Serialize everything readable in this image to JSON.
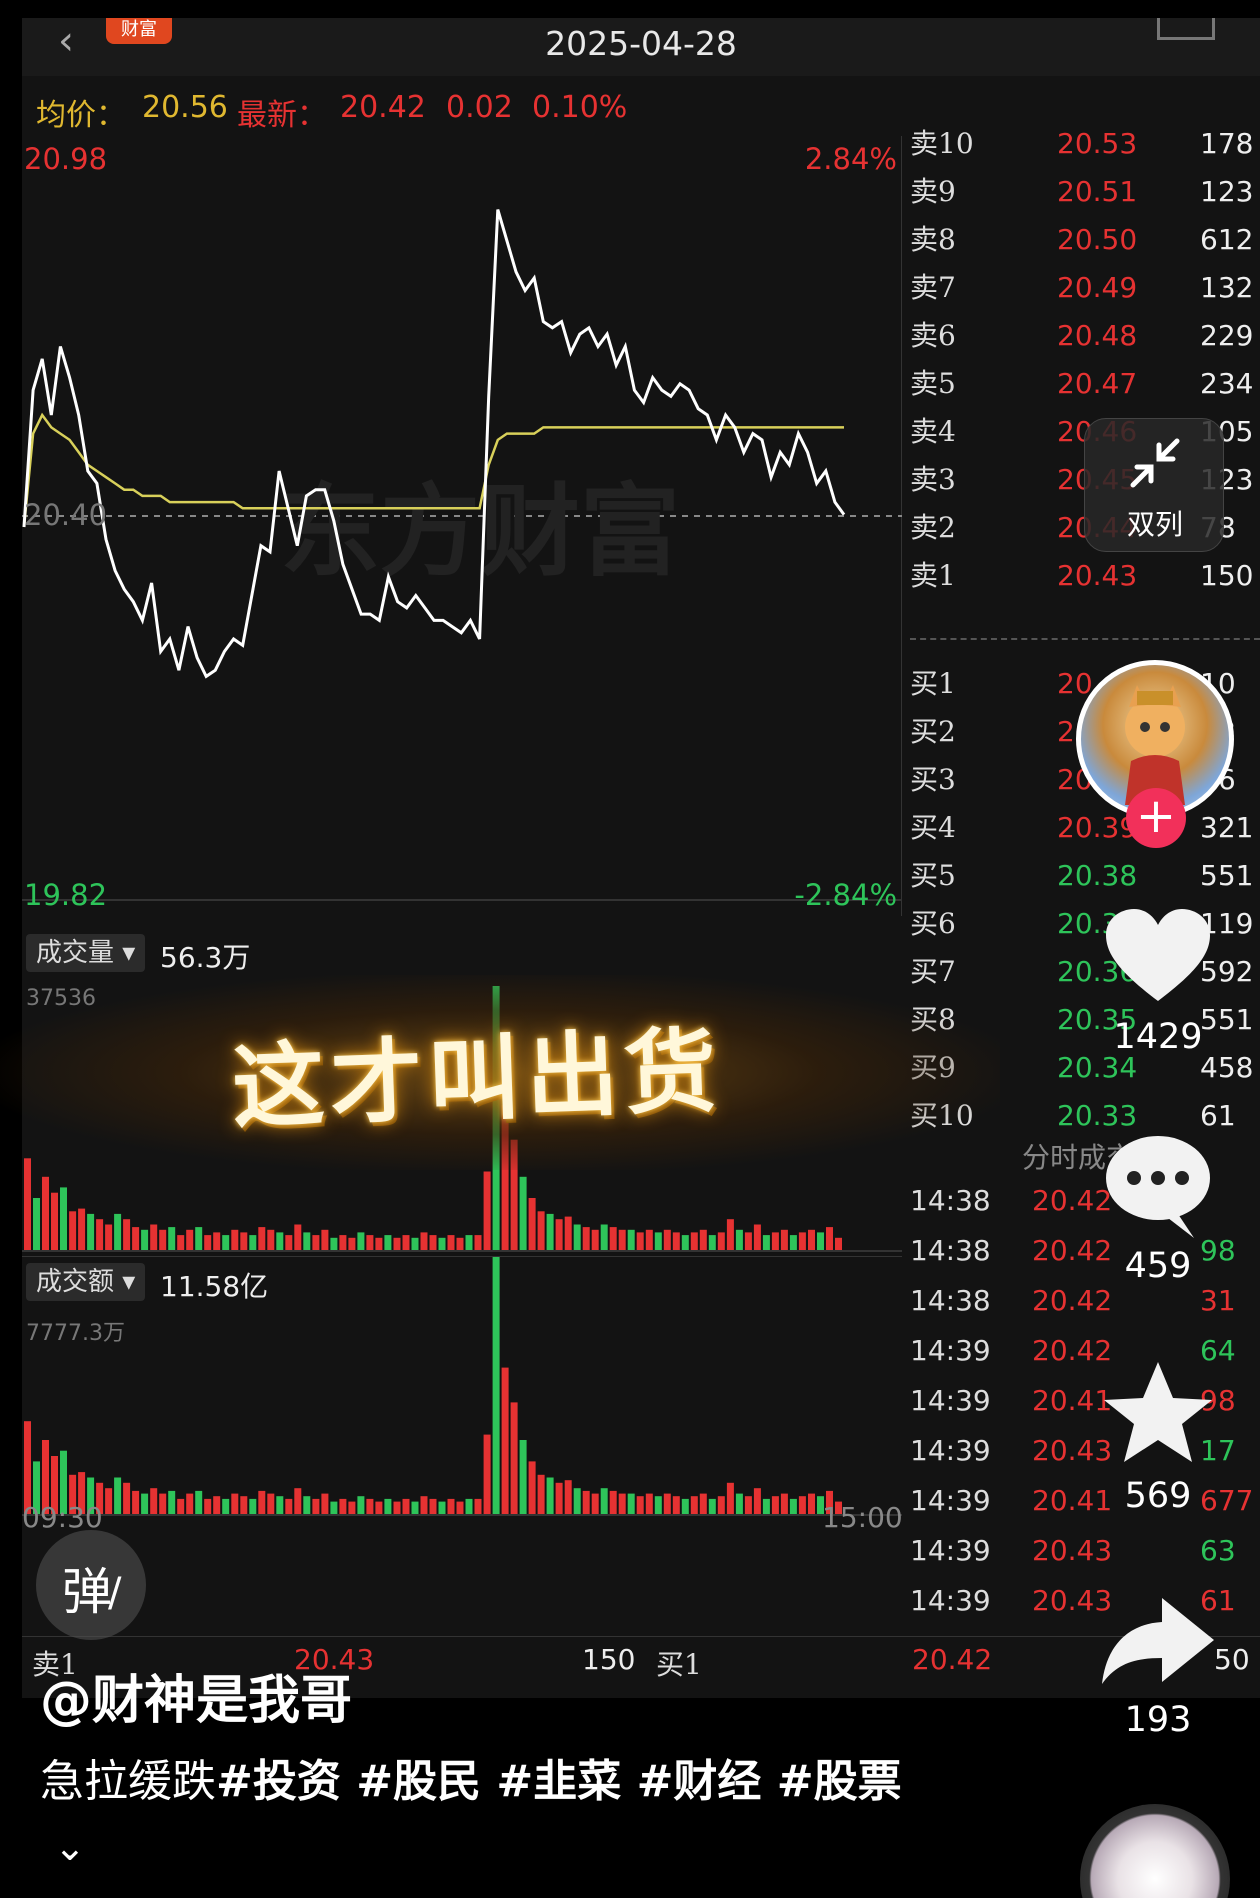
{
  "header": {
    "date": "2025-04-28",
    "badge": "财富"
  },
  "stats": {
    "avg_label": "均价：",
    "avg_value": "20.56",
    "latest_label": "最新：",
    "latest_value": "20.42",
    "change": "0.02",
    "change_pct": "0.10%"
  },
  "price_chart": {
    "y_max_label": "20.98",
    "y_min_label": "19.82",
    "pct_max_label": "2.84%",
    "pct_min_label": "-2.84%",
    "ref_label": "20.40",
    "watermark": "东方财富"
  },
  "volume_panel": {
    "tag": "成交量",
    "total": "56.3万",
    "max_label": "37536"
  },
  "amount_panel": {
    "tag": "成交额",
    "total": "11.58亿",
    "max_label": "7777.3万"
  },
  "time_axis": {
    "start": "09:30",
    "end": "15:00"
  },
  "banner": {
    "text": "这才叫出货"
  },
  "order_book": {
    "asks": [
      {
        "label": "卖10",
        "price": "20.53",
        "vol": "178"
      },
      {
        "label": "卖9",
        "price": "20.51",
        "vol": "123"
      },
      {
        "label": "卖8",
        "price": "20.50",
        "vol": "612"
      },
      {
        "label": "卖7",
        "price": "20.49",
        "vol": "132"
      },
      {
        "label": "卖6",
        "price": "20.48",
        "vol": "229"
      },
      {
        "label": "卖5",
        "price": "20.47",
        "vol": "234"
      },
      {
        "label": "卖4",
        "price": "20.46",
        "vol": "105"
      },
      {
        "label": "卖3",
        "price": "20.45",
        "vol": "123"
      },
      {
        "label": "卖2",
        "price": "20.44",
        "vol": "78"
      },
      {
        "label": "卖1",
        "price": "20.43",
        "vol": "150"
      }
    ],
    "bids": [
      {
        "label": "买1",
        "price": "20.42",
        "vol": "10"
      },
      {
        "label": "买2",
        "price": "20.41",
        "vol": "98"
      },
      {
        "label": "买3",
        "price": "20.40",
        "vol": "66"
      },
      {
        "label": "买4",
        "price": "20.39",
        "vol": "321"
      },
      {
        "label": "买5",
        "price": "20.38",
        "vol": "551"
      },
      {
        "label": "买6",
        "price": "20.37",
        "vol": "119"
      },
      {
        "label": "买7",
        "price": "20.36",
        "vol": "592"
      },
      {
        "label": "买8",
        "price": "20.35",
        "vol": "551"
      },
      {
        "label": "买9",
        "price": "20.34",
        "vol": "458"
      },
      {
        "label": "买10",
        "price": "20.33",
        "vol": "61"
      }
    ]
  },
  "ticks": {
    "title": "分时成交",
    "rows": [
      {
        "time": "14:38",
        "price": "20.42",
        "vol": ""
      },
      {
        "time": "14:38",
        "price": "20.42",
        "vol": "98"
      },
      {
        "time": "14:38",
        "price": "20.42",
        "vol": "31"
      },
      {
        "time": "14:39",
        "price": "20.42",
        "vol": "64"
      },
      {
        "time": "14:39",
        "price": "20.41",
        "vol": "98"
      },
      {
        "time": "14:39",
        "price": "20.43",
        "vol": "17"
      },
      {
        "time": "14:39",
        "price": "20.41",
        "vol": "677"
      },
      {
        "time": "14:39",
        "price": "20.43",
        "vol": "63"
      },
      {
        "time": "14:39",
        "price": "20.43",
        "vol": "61"
      }
    ]
  },
  "bottom_row": {
    "sell_label": "卖1",
    "sell_price": "20.43",
    "mid_vol": "150",
    "buy_label": "买1",
    "latest": "20.42",
    "vol": "50"
  },
  "float_button": {
    "label": "双列"
  },
  "danmaku": {
    "label": "弹"
  },
  "actions": {
    "likes": "1429",
    "comments": "459",
    "favorites": "569",
    "shares": "193"
  },
  "caption": {
    "author": "@财神是我哥",
    "text": "急拉缓跌",
    "hashtags": [
      "#投资",
      "#股民",
      "#韭菜",
      "#财经",
      "#股票"
    ]
  },
  "colors": {
    "up": "#e63232",
    "down": "#2ec45a",
    "avg_line": "#d8d05a",
    "price_line": "#ffffff"
  },
  "chart_data": {
    "type": "line",
    "title": "",
    "xlabel": "",
    "ylabel": "",
    "x_range": [
      "09:30",
      "15:00"
    ],
    "ylim": [
      19.82,
      20.98
    ],
    "reference": 20.4,
    "series": [
      {
        "values": [
          20.4,
          20.62,
          20.67,
          20.58,
          20.69,
          20.64,
          20.58,
          20.49,
          20.47,
          20.38,
          20.33,
          20.3,
          20.28,
          20.25,
          20.31,
          20.2,
          20.22,
          20.17,
          20.24,
          20.19,
          20.16,
          20.17,
          20.2,
          20.22,
          20.21,
          20.29,
          20.37,
          20.36,
          20.49,
          20.43,
          20.37,
          20.45,
          20.46,
          20.46,
          20.41,
          20.34,
          20.3,
          20.26,
          20.26,
          20.25,
          20.32,
          20.28,
          20.27,
          20.29,
          20.27,
          20.25,
          20.25,
          20.24,
          20.23,
          20.25,
          20.22,
          20.61,
          20.91,
          20.86,
          20.81,
          20.78,
          20.8,
          20.73,
          20.72,
          20.73,
          20.68,
          20.71,
          20.72,
          20.69,
          20.71,
          20.66,
          20.69,
          20.62,
          20.6,
          20.64,
          20.62,
          20.61,
          20.63,
          20.62,
          20.59,
          20.58,
          20.54,
          20.58,
          20.56,
          20.52,
          20.55,
          20.54,
          20.48,
          20.52,
          20.5,
          20.55,
          20.52,
          20.47,
          20.49,
          20.44,
          20.42
        ]
      },
      {
        "values": [
          20.4,
          20.55,
          20.58,
          20.56,
          20.55,
          20.54,
          20.52,
          20.5,
          20.49,
          20.48,
          20.47,
          20.46,
          20.46,
          20.45,
          20.45,
          20.45,
          20.44,
          20.44,
          20.44,
          20.44,
          20.44,
          20.44,
          20.44,
          20.44,
          20.43,
          20.43,
          20.43,
          20.43,
          20.43,
          20.43,
          20.43,
          20.43,
          20.43,
          20.43,
          20.43,
          20.43,
          20.43,
          20.43,
          20.43,
          20.43,
          20.43,
          20.43,
          20.43,
          20.43,
          20.43,
          20.43,
          20.43,
          20.43,
          20.43,
          20.43,
          20.43,
          20.5,
          20.54,
          20.55,
          20.55,
          20.55,
          20.55,
          20.56,
          20.56,
          20.56,
          20.56,
          20.56,
          20.56,
          20.56,
          20.56,
          20.56,
          20.56,
          20.56,
          20.56,
          20.56,
          20.56,
          20.56,
          20.56,
          20.56,
          20.56,
          20.56,
          20.56,
          20.56,
          20.56,
          20.56,
          20.56,
          20.56,
          20.56,
          20.56,
          20.56,
          20.56,
          20.56,
          20.56,
          20.56,
          20.56,
          20.56
        ]
      }
    ],
    "volume": [
      35,
      20,
      28,
      22,
      24,
      15,
      16,
      14,
      12,
      10,
      14,
      12,
      9,
      8,
      10,
      8,
      9,
      6,
      8,
      9,
      6,
      7,
      6,
      8,
      7,
      6,
      9,
      8,
      7,
      6,
      10,
      7,
      6,
      8,
      5,
      6,
      5,
      7,
      6,
      5,
      6,
      5,
      6,
      5,
      7,
      6,
      5,
      6,
      5,
      6,
      6,
      30,
      100,
      55,
      42,
      28,
      20,
      15,
      14,
      12,
      13,
      10,
      9,
      8,
      10,
      9,
      8,
      8,
      7,
      8,
      7,
      8,
      7,
      6,
      7,
      8,
      6,
      7,
      12,
      8,
      7,
      10,
      6,
      7,
      8,
      6,
      7,
      8,
      7,
      9,
      5
    ],
    "amount": [
      35,
      20,
      28,
      22,
      24,
      15,
      16,
      14,
      12,
      10,
      14,
      12,
      9,
      8,
      10,
      8,
      9,
      6,
      8,
      9,
      6,
      7,
      6,
      8,
      7,
      6,
      9,
      8,
      7,
      6,
      10,
      7,
      6,
      8,
      5,
      6,
      5,
      7,
      6,
      5,
      6,
      5,
      6,
      5,
      7,
      6,
      5,
      6,
      5,
      6,
      6,
      30,
      100,
      55,
      42,
      28,
      20,
      15,
      14,
      12,
      13,
      10,
      9,
      8,
      10,
      9,
      8,
      8,
      7,
      8,
      7,
      8,
      7,
      6,
      7,
      8,
      6,
      7,
      12,
      8,
      7,
      10,
      6,
      7,
      8,
      6,
      7,
      8,
      7,
      9,
      5
    ]
  }
}
